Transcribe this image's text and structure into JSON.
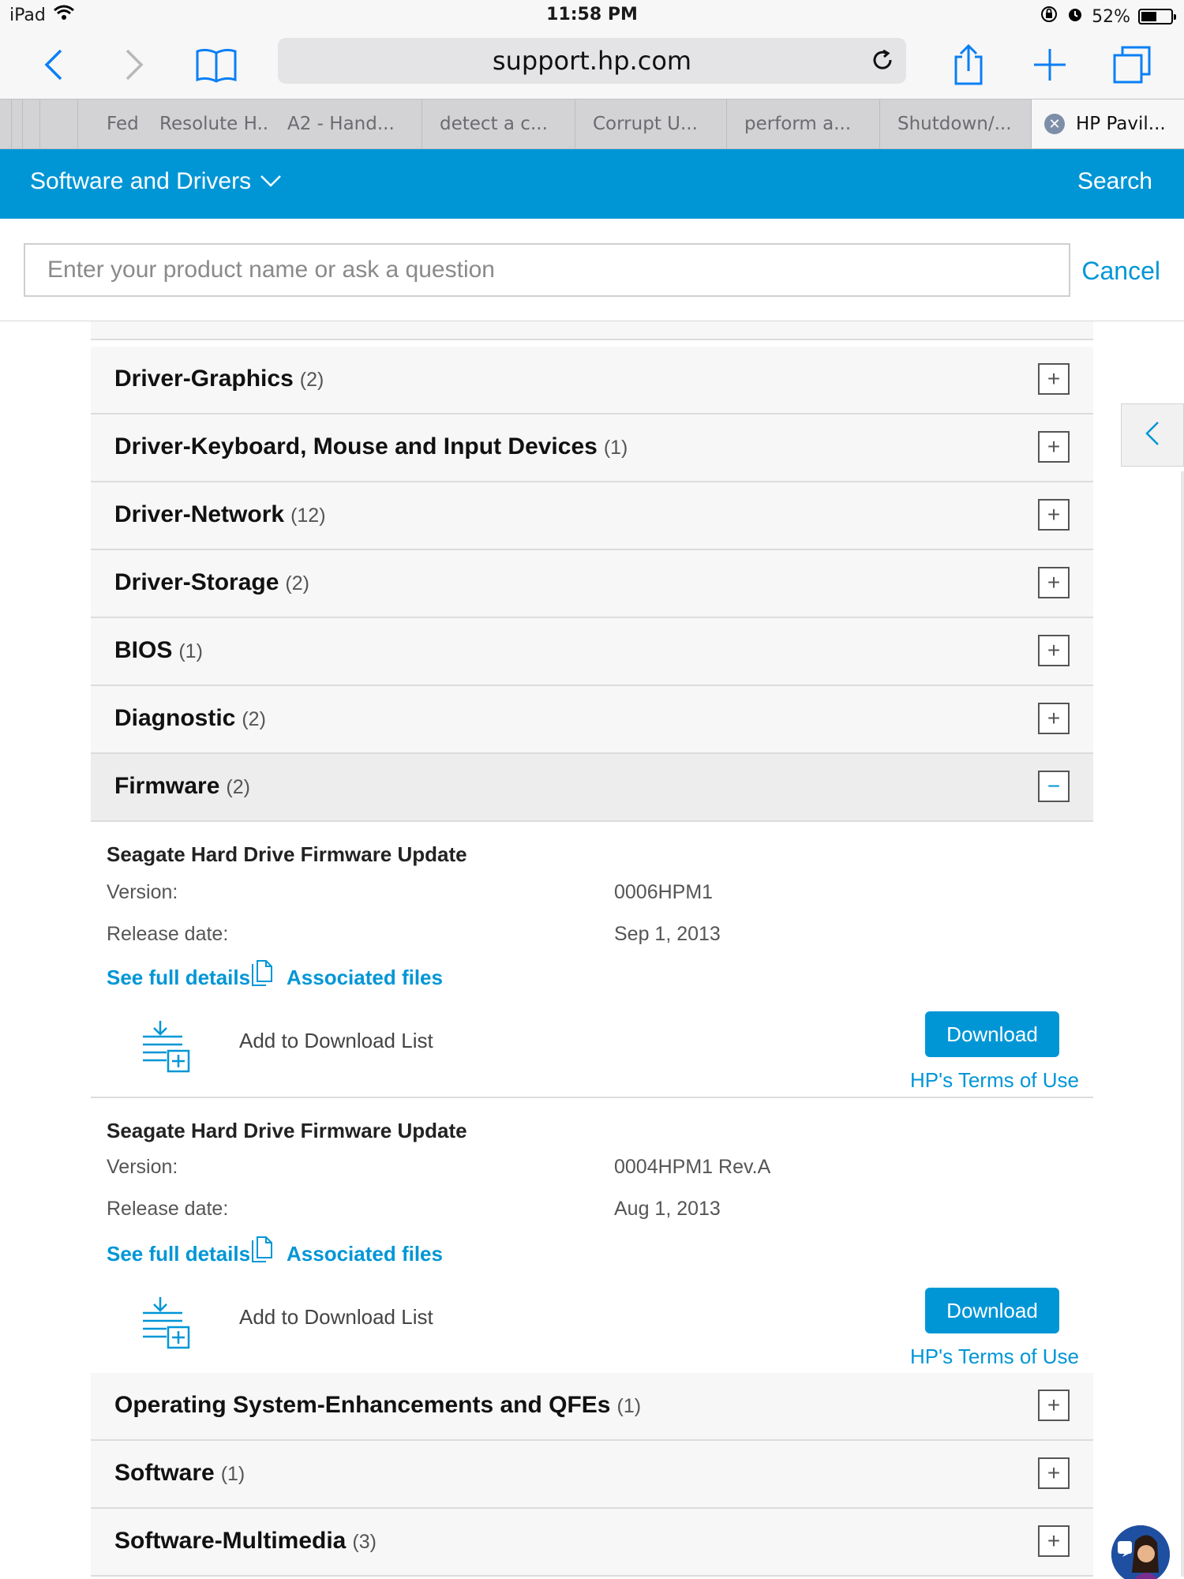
{
  "status_bar": {
    "device": "iPad",
    "time": "11:58 PM",
    "battery": "52%",
    "battery_level": 0.52
  },
  "browser": {
    "url": "support.hp.com",
    "icons": [
      "back-icon",
      "forward-icon",
      "bookmarks-icon",
      "reload-icon",
      "share-icon",
      "new-tab-icon",
      "tabs-icon"
    ],
    "tabs": [
      {
        "label": "Fed"
      },
      {
        "label": "Resolute H.."
      },
      {
        "label": "A2 - Hand..."
      },
      {
        "label": "detect a c..."
      },
      {
        "label": "Corrupt U..."
      },
      {
        "label": "perform a..."
      },
      {
        "label": "Shutdown/..."
      },
      {
        "label": "HP Pavil...",
        "active": true
      }
    ]
  },
  "hp_header": {
    "title": "Software and Drivers",
    "search": "Search"
  },
  "search": {
    "placeholder": "Enter your product name or ask a question",
    "cancel": "Cancel"
  },
  "categories_top": [
    {
      "name": "Driver-Graphics",
      "count": "(2)"
    },
    {
      "name": "Driver-Keyboard, Mouse and Input Devices",
      "count": "(1)"
    },
    {
      "name": "Driver-Network",
      "count": "(12)"
    },
    {
      "name": "Driver-Storage",
      "count": "(2)"
    },
    {
      "name": "BIOS",
      "count": "(1)"
    },
    {
      "name": "Diagnostic",
      "count": "(2)"
    },
    {
      "name": "Firmware",
      "count": "(2)"
    }
  ],
  "firmware_items": [
    {
      "title": "Seagate Hard Drive Firmware Update",
      "version_label": "Version:",
      "version": "0006HPM1",
      "date_label": "Release date:",
      "date": "Sep 1, 2013",
      "details_link": "See full details",
      "files_link": "Associated files",
      "add_list": "Add to Download List",
      "download": "Download",
      "terms": "HP's Terms of Use"
    },
    {
      "title": "Seagate Hard Drive Firmware Update",
      "version_label": "Version:",
      "version": "0004HPM1 Rev.A",
      "date_label": "Release date:",
      "date": "Aug 1, 2013",
      "details_link": "See full details",
      "files_link": "Associated files",
      "add_list": "Add to Download List",
      "download": "Download",
      "terms": "HP's Terms of Use"
    }
  ],
  "categories_bottom": [
    {
      "name": "Operating System-Enhancements and QFEs",
      "count": "(1)"
    },
    {
      "name": "Software",
      "count": "(1)"
    },
    {
      "name": "Software-Multimedia",
      "count": "(3)"
    }
  ],
  "toggles": {
    "plus": "+",
    "minus": "−"
  },
  "colors": {
    "accent": "#0096d6",
    "row_bg": "#f7f7f7",
    "tab_bar": "#d3d3d6"
  }
}
